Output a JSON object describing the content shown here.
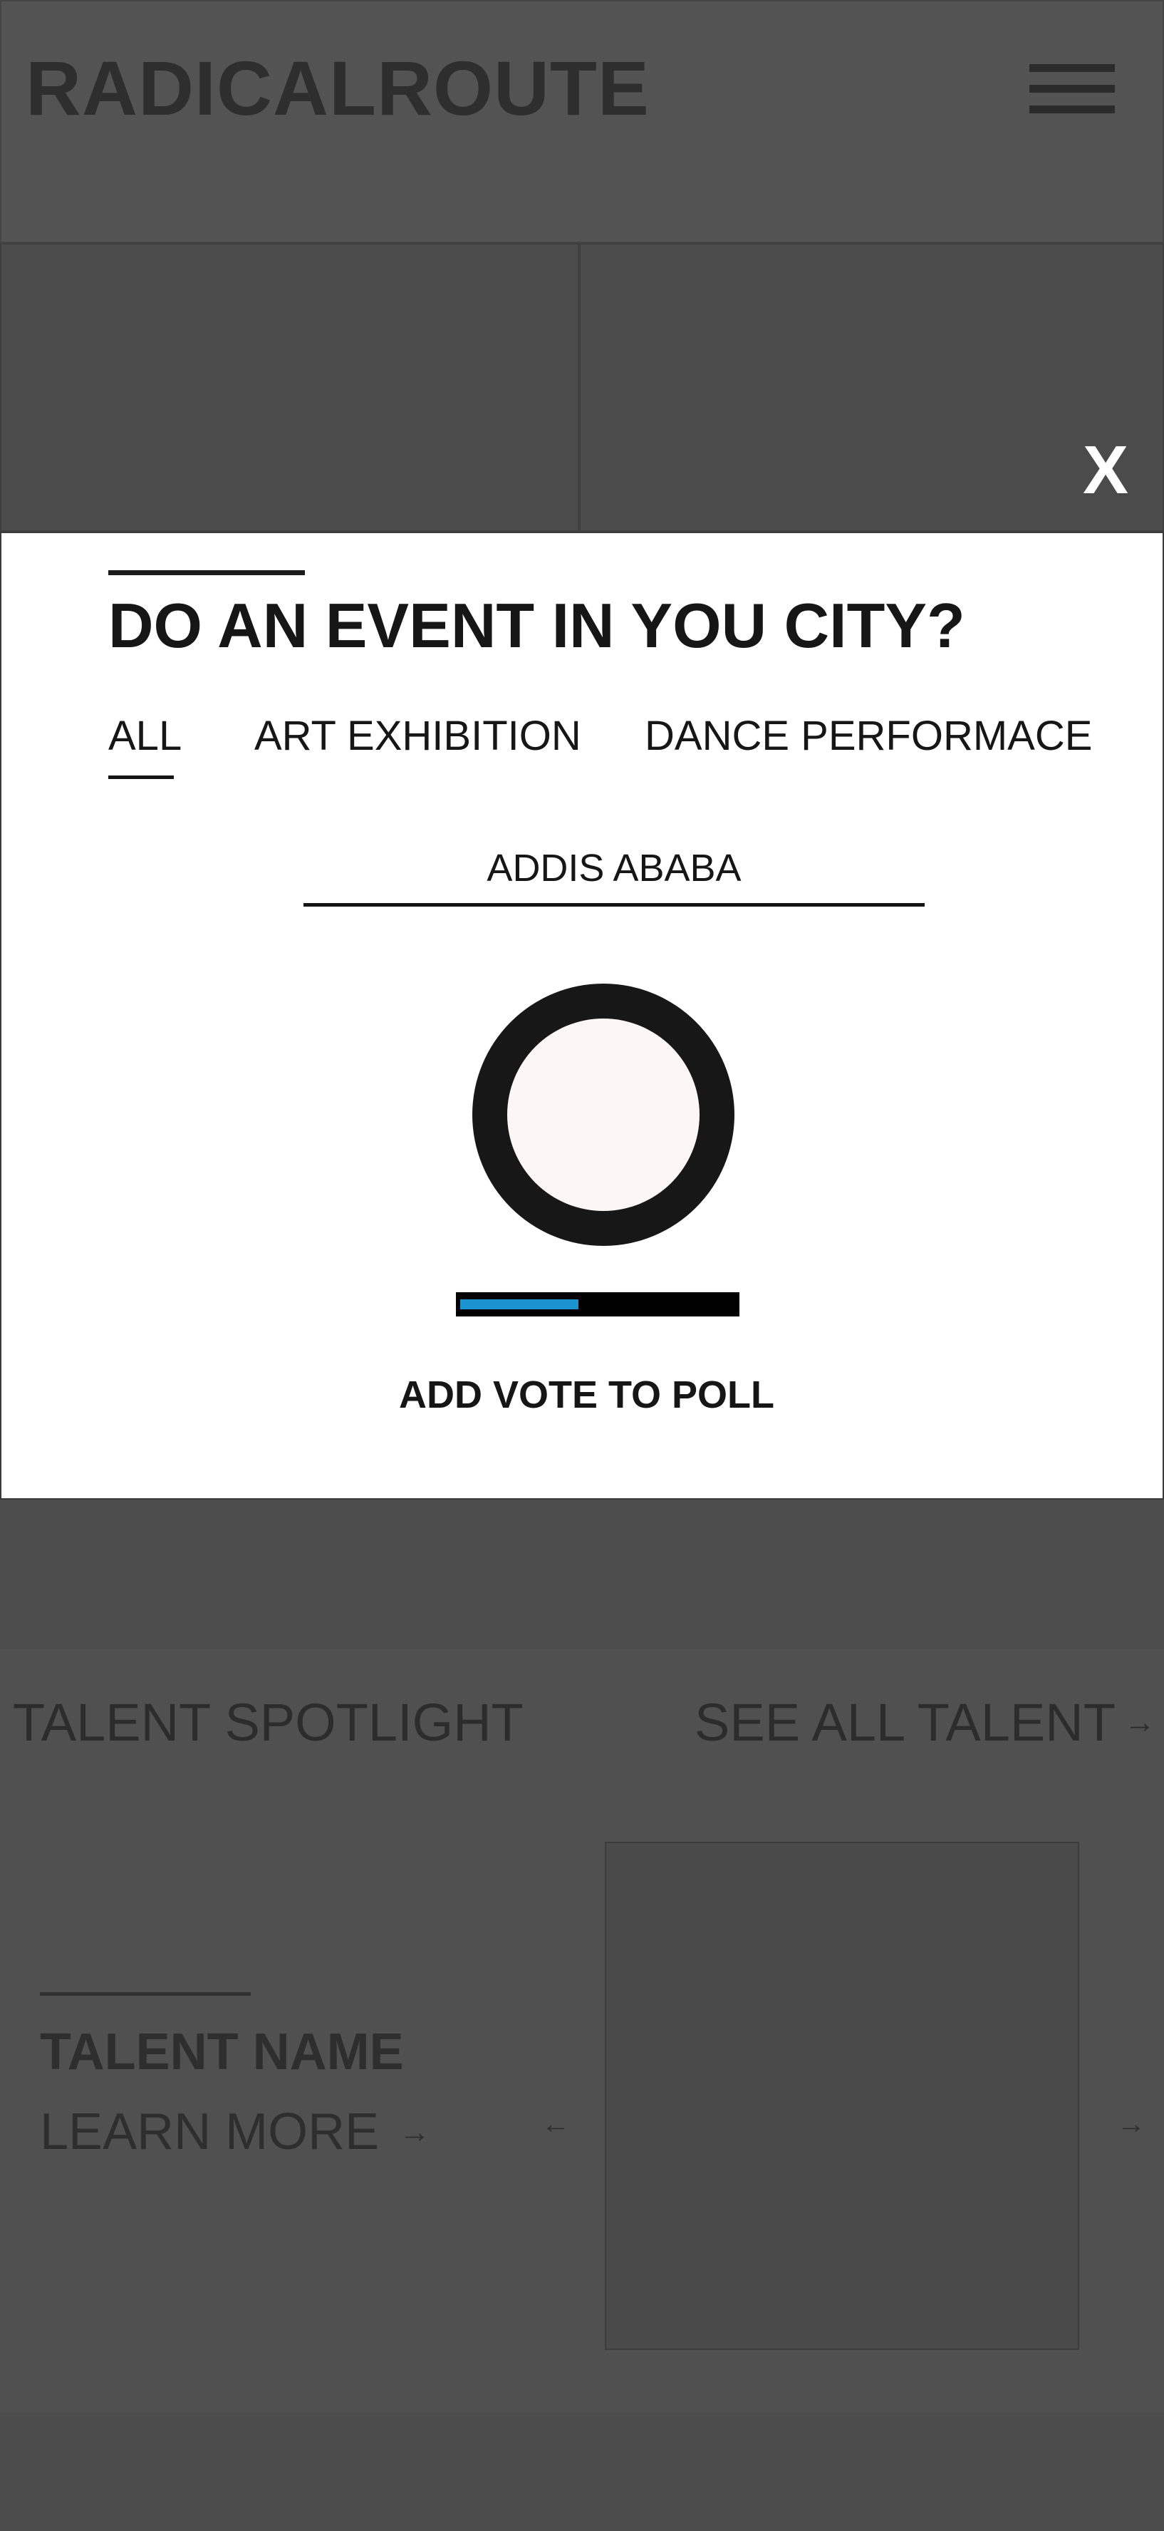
{
  "header": {
    "logo": "RADICALROUTE",
    "menu_icon": "hamburger-icon"
  },
  "modal": {
    "close_label": "X",
    "title": "DO AN EVENT IN YOU CITY?",
    "tabs": [
      {
        "label": "ALL",
        "active": true
      },
      {
        "label": "ART EXHIBITION",
        "active": false
      },
      {
        "label": "DANCE PERFORMACE",
        "active": false
      }
    ],
    "city_value": "ADDIS ABABA",
    "poll_progress": 0.43,
    "vote_button": "ADD VOTE TO POLL",
    "colors": {
      "progress_fill": "#1b93d1",
      "progress_track": "#000000",
      "ring": "#171717"
    }
  },
  "talent": {
    "heading": "TALENT SPOTLIGHT",
    "see_all": "SEE ALL TALENT",
    "see_all_arrow": "→",
    "name": "TALENT NAME",
    "learn_more": "LEARN MORE",
    "learn_more_arrow": "→",
    "prev_arrow": "←",
    "next_arrow": "→"
  }
}
